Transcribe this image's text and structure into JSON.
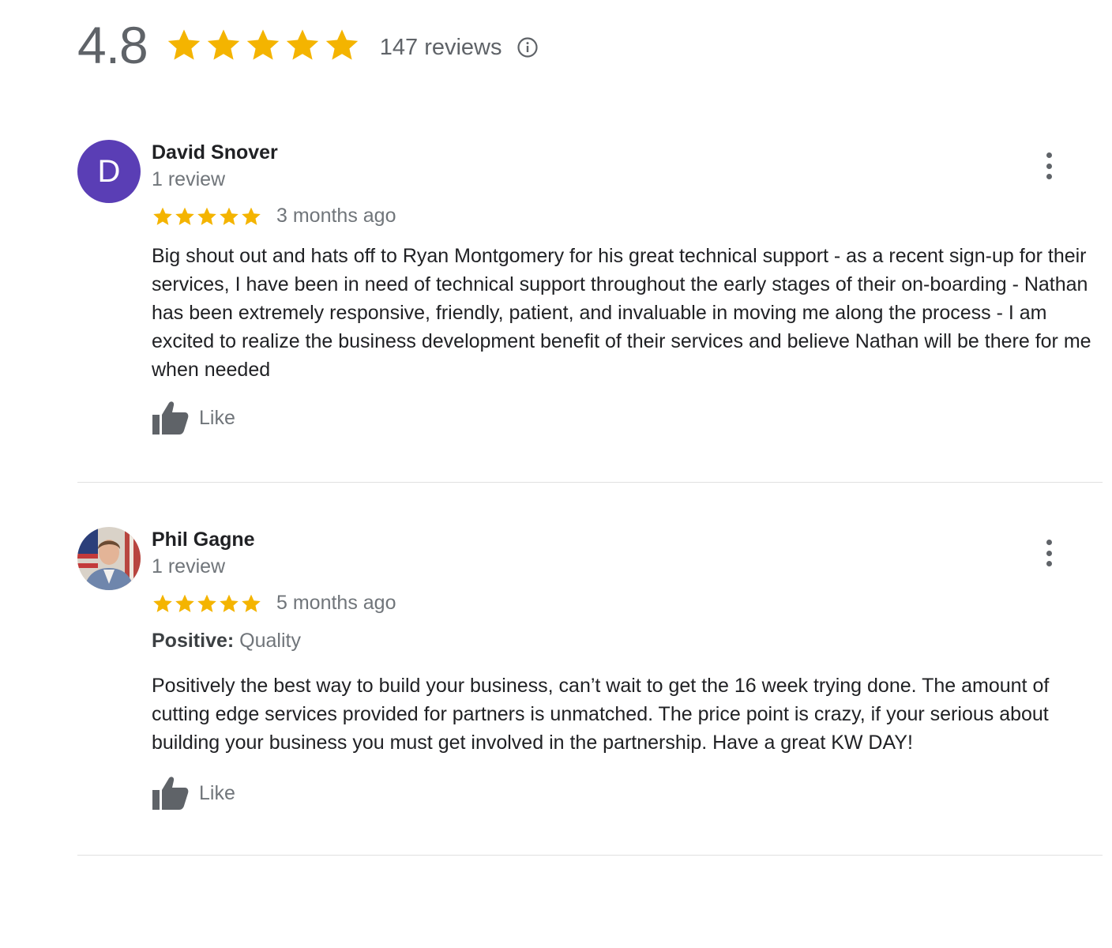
{
  "summary": {
    "rating": "4.8",
    "stars": 5,
    "total_reviews": "147 reviews",
    "info_icon": "info-icon"
  },
  "colors": {
    "star": "#f4b400",
    "avatar_letter_bg": "#5a3eb5",
    "muted_text": "#70757a",
    "divider": "#e0e0e0"
  },
  "reviews": [
    {
      "avatar_letter": "D",
      "name": "David Snover",
      "review_count": "1 review",
      "stars": 5,
      "time_ago": "3 months ago",
      "text": "Big shout out and hats off to Ryan Montgomery for his great technical support - as a recent sign-up for their services, I have been in need of technical support throughout the early stages of their on-boarding - Nathan has been extremely responsive, friendly, patient, and invaluable in moving me along the process - I am excited to realize the business development benefit of their services and believe Nathan will be there for me when needed",
      "like_label": "Like",
      "icons": [
        "more-vert-icon",
        "thumbs-up-icon"
      ]
    },
    {
      "avatar": "photo-avatar",
      "name": "Phil Gagne",
      "review_count": "1 review",
      "stars": 5,
      "time_ago": "5 months ago",
      "attribute_key": "Positive:",
      "attribute_value": "Quality",
      "text": "Positively the best way to build your business, can’t wait to get the 16 week trying done.  The amount of cutting edge services provided for partners is unmatched.  The price point is crazy, if your serious about building your business you must get involved in the partnership.  Have a great KW DAY!",
      "like_label": "Like",
      "icons": [
        "more-vert-icon",
        "thumbs-up-icon"
      ]
    }
  ]
}
